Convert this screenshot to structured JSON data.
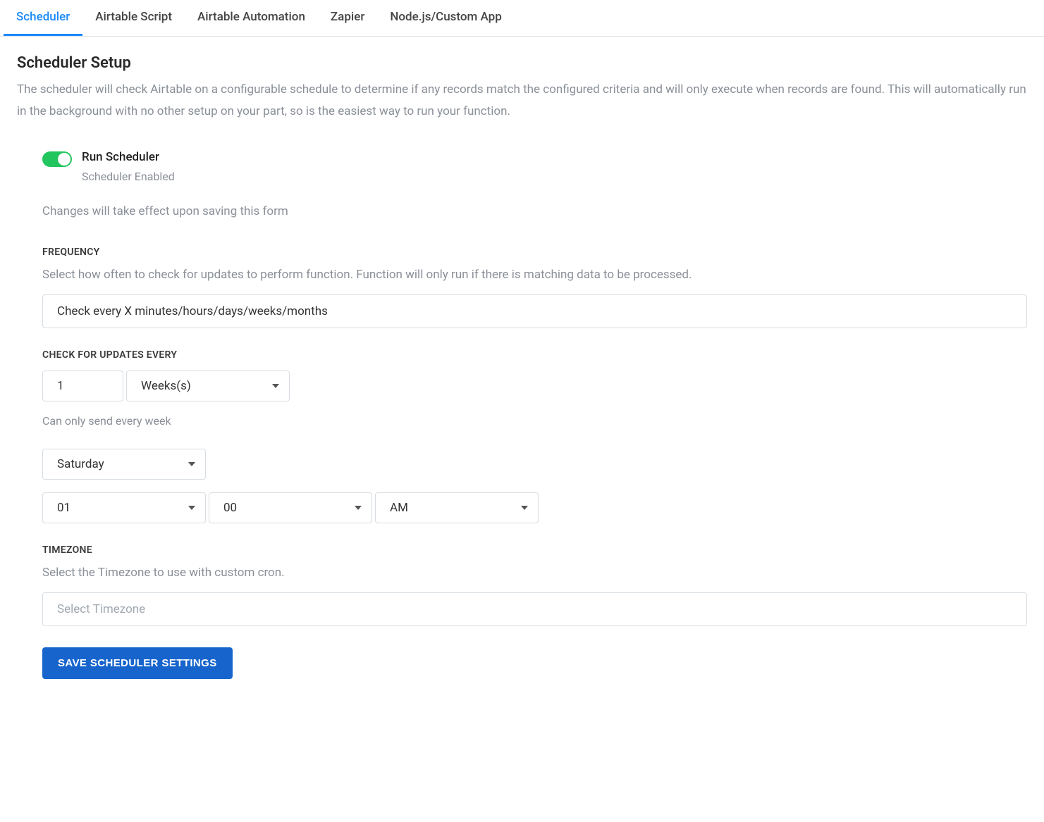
{
  "tabs": [
    {
      "label": "Scheduler",
      "active": true
    },
    {
      "label": "Airtable Script",
      "active": false
    },
    {
      "label": "Airtable Automation",
      "active": false
    },
    {
      "label": "Zapier",
      "active": false
    },
    {
      "label": "Node.js/Custom App",
      "active": false
    }
  ],
  "header": {
    "title": "Scheduler Setup",
    "description": "The scheduler will check Airtable on a configurable schedule to determine if any records match the configured criteria and will only execute when records are found. This will automatically run in the background with no other setup on your part, so is the easiest way to run your function."
  },
  "toggle": {
    "label": "Run Scheduler",
    "status": "Scheduler Enabled",
    "enabled": true,
    "note": "Changes will take effect upon saving this form"
  },
  "frequency": {
    "label": "FREQUENCY",
    "description": "Select how often to check for updates to perform function. Function will only run if there is matching data to be processed.",
    "value": "Check every X minutes/hours/days/weeks/months"
  },
  "interval": {
    "label": "CHECK FOR UPDATES EVERY",
    "number": "1",
    "unit": "Weeks(s)",
    "helper": "Can only send every week",
    "day": "Saturday",
    "hour": "01",
    "minute": "00",
    "ampm": "AM"
  },
  "timezone": {
    "label": "TIMEZONE",
    "description": "Select the Timezone to use with custom cron.",
    "placeholder": "Select Timezone",
    "value": ""
  },
  "save_button": "SAVE SCHEDULER SETTINGS"
}
